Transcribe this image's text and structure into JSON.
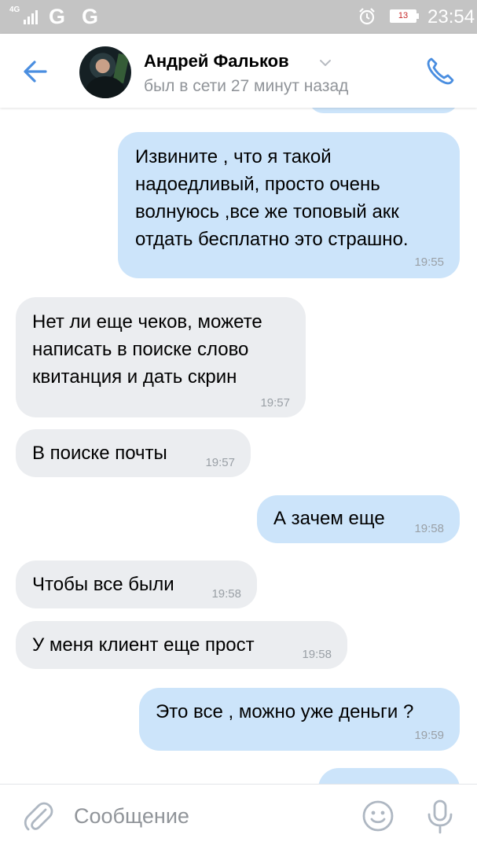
{
  "status_bar": {
    "network": "4G",
    "carrier_icons": [
      "G",
      "G"
    ],
    "battery": "13",
    "time": "23:54"
  },
  "header": {
    "contact_name": "Андрей Фальков",
    "contact_status": "был в сети 27 минут назад"
  },
  "messages": [
    {
      "direction": "out",
      "lines": [
        "Извините , что я такой",
        "надоедливый, просто очень",
        "волнуюсь ,все же топовый акк",
        "отдать бесплатно это страшно."
      ],
      "time": "19:55"
    },
    {
      "direction": "in",
      "lines": [
        "Нет ли еще чеков, можете",
        "написать в поиске слово",
        "квитанция и дать скрин"
      ],
      "time": "19:57"
    },
    {
      "direction": "in",
      "lines": [
        "В поиске почты"
      ],
      "time": "19:57"
    },
    {
      "direction": "out",
      "lines": [
        "А зачем еще"
      ],
      "time": "19:58"
    },
    {
      "direction": "in",
      "lines": [
        "Чтобы все были"
      ],
      "time": "19:58"
    },
    {
      "direction": "in",
      "lines": [
        "У меня клиент еще прост"
      ],
      "time": "19:58"
    },
    {
      "direction": "out",
      "lines": [
        "Это все , можно уже деньги ?"
      ],
      "time": "19:59"
    }
  ],
  "input": {
    "placeholder": "Сообщение"
  },
  "colors": {
    "incoming_bubble": "#ebedf0",
    "outgoing_bubble": "#cce4fa",
    "accent": "#4a8ee0",
    "status_bar": "#c4c4c4"
  },
  "icons": [
    "back-arrow-icon",
    "chevron-down-icon",
    "phone-icon",
    "paperclip-icon",
    "smile-icon",
    "microphone-icon",
    "alarm-icon",
    "battery-icon",
    "signal-icon"
  ]
}
